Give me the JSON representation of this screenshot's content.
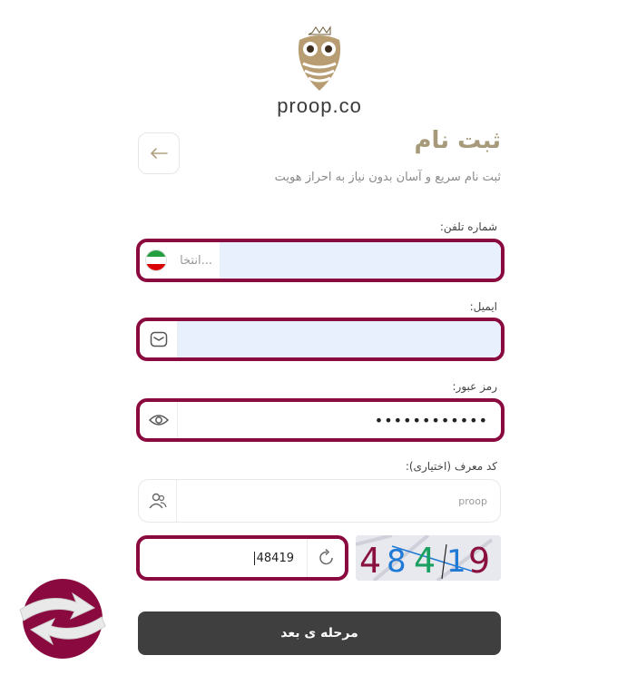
{
  "brand": {
    "name": "proop.co"
  },
  "header": {
    "title": "ثبت نام",
    "subtitle": "ثبت نام سریع و آسان بدون نیاز به احراز هویت"
  },
  "form": {
    "phone": {
      "label": "شماره تلفن:",
      "country_placeholder": "انتخا...",
      "value": "",
      "flag": "iran-flag"
    },
    "email": {
      "label": "ایمیل:",
      "value": ""
    },
    "password": {
      "label": "رمز عبور:",
      "value": "••••••••••••"
    },
    "referral": {
      "label": "کد معرف (اختیاری):",
      "placeholder": "proop"
    },
    "captcha": {
      "value": "48419",
      "image_text": "48419"
    }
  },
  "submit": {
    "label": "مرحله ی بعد"
  },
  "colors": {
    "accent_border": "#8a0a3f",
    "title": "#a79a7a",
    "submit_bg": "#3f3f3f"
  }
}
